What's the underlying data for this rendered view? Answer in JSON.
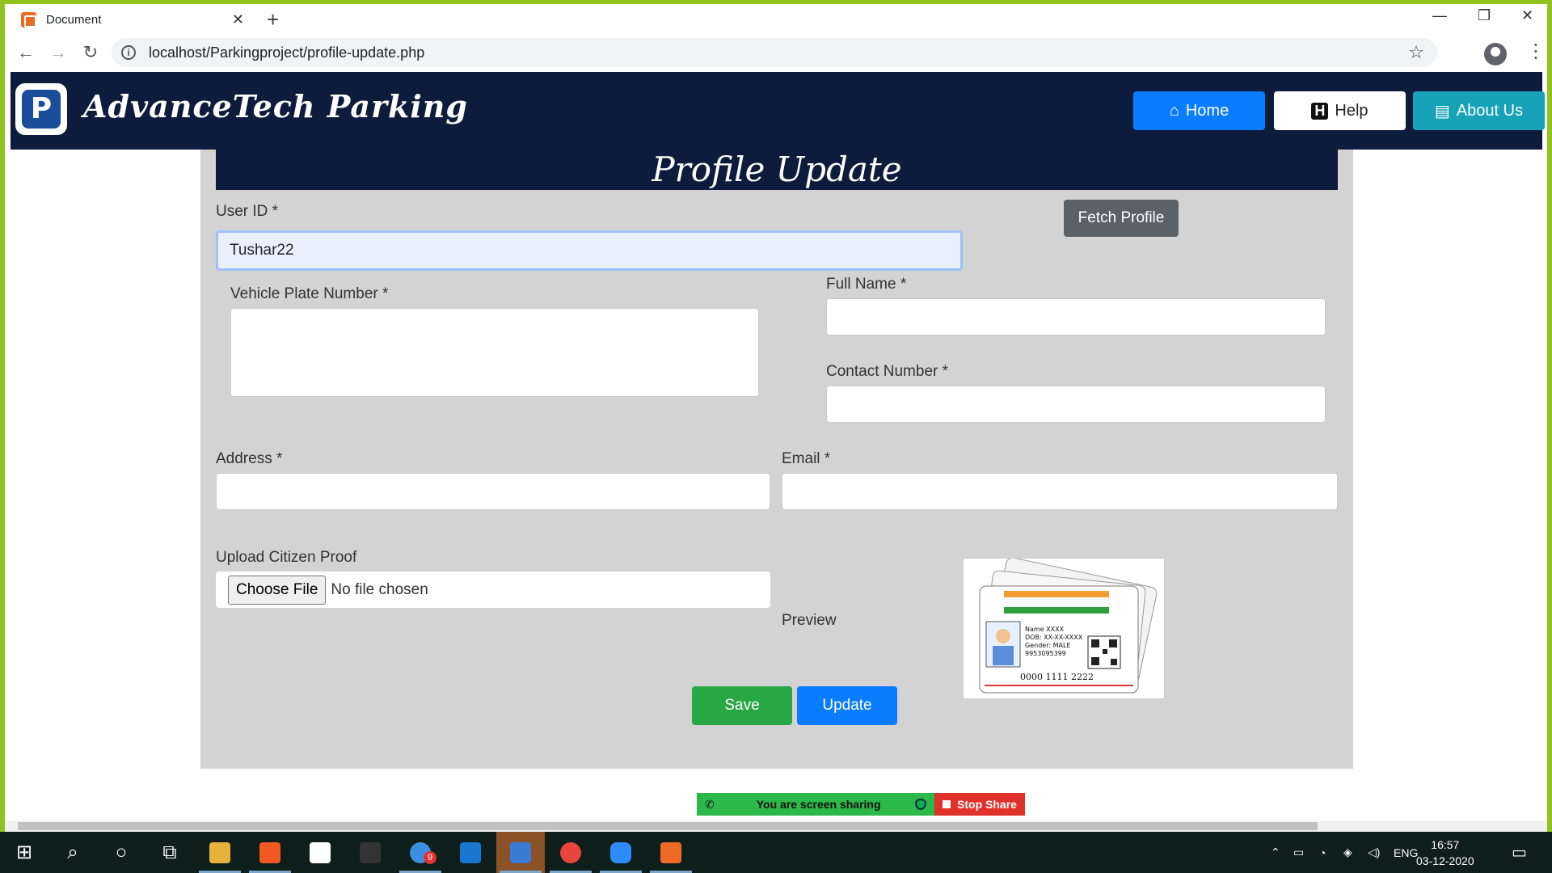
{
  "browser": {
    "tab_title": "Document",
    "tab_close": "✕",
    "new_tab": "+",
    "url": "localhost/Parkingproject/profile-update.php",
    "win_minimize": "—",
    "win_restore": "❐",
    "win_close": "✕"
  },
  "header": {
    "logo_letter": "P",
    "brand": "AdvanceTech Parking",
    "nav": [
      {
        "label": "Home",
        "icon": "home-icon"
      },
      {
        "label": "Help",
        "icon": "help-icon"
      },
      {
        "label": "About Us",
        "icon": "id-card-icon"
      }
    ]
  },
  "form": {
    "title": "Profile Update",
    "user_id_label": "User ID *",
    "user_id_value": "Tushar22",
    "fetch_button": "Fetch Profile",
    "vehicle_label": "Vehicle Plate Number *",
    "full_name_label": "Full Name *",
    "contact_label": "Contact Number *",
    "address_label": "Address *",
    "email_label": "Email *",
    "upload_label": "Upload Citizen Proof",
    "choose_file": "Choose File",
    "no_file": "No file chosen",
    "preview_label": "Preview",
    "save_button": "Save",
    "update_button": "Update"
  },
  "preview_card": {
    "name": "Name XXXX",
    "dob": "DOB: XX-XX-XXXX",
    "gender": "Gender: MALE",
    "phone": "9953095399",
    "number": "0000 1111 2222"
  },
  "screen_share": {
    "message": "You are screen sharing",
    "stop": "Stop Share"
  },
  "taskbar": {
    "lang": "ENG",
    "time": "16:57",
    "date": "03-12-2020",
    "badge": "9"
  },
  "colors": {
    "navbar": "#0d1b3d",
    "home": "#0a7cff",
    "about": "#17a2b8",
    "save": "#28a745",
    "update": "#0a7cff",
    "panel": "#d3d3d3"
  }
}
